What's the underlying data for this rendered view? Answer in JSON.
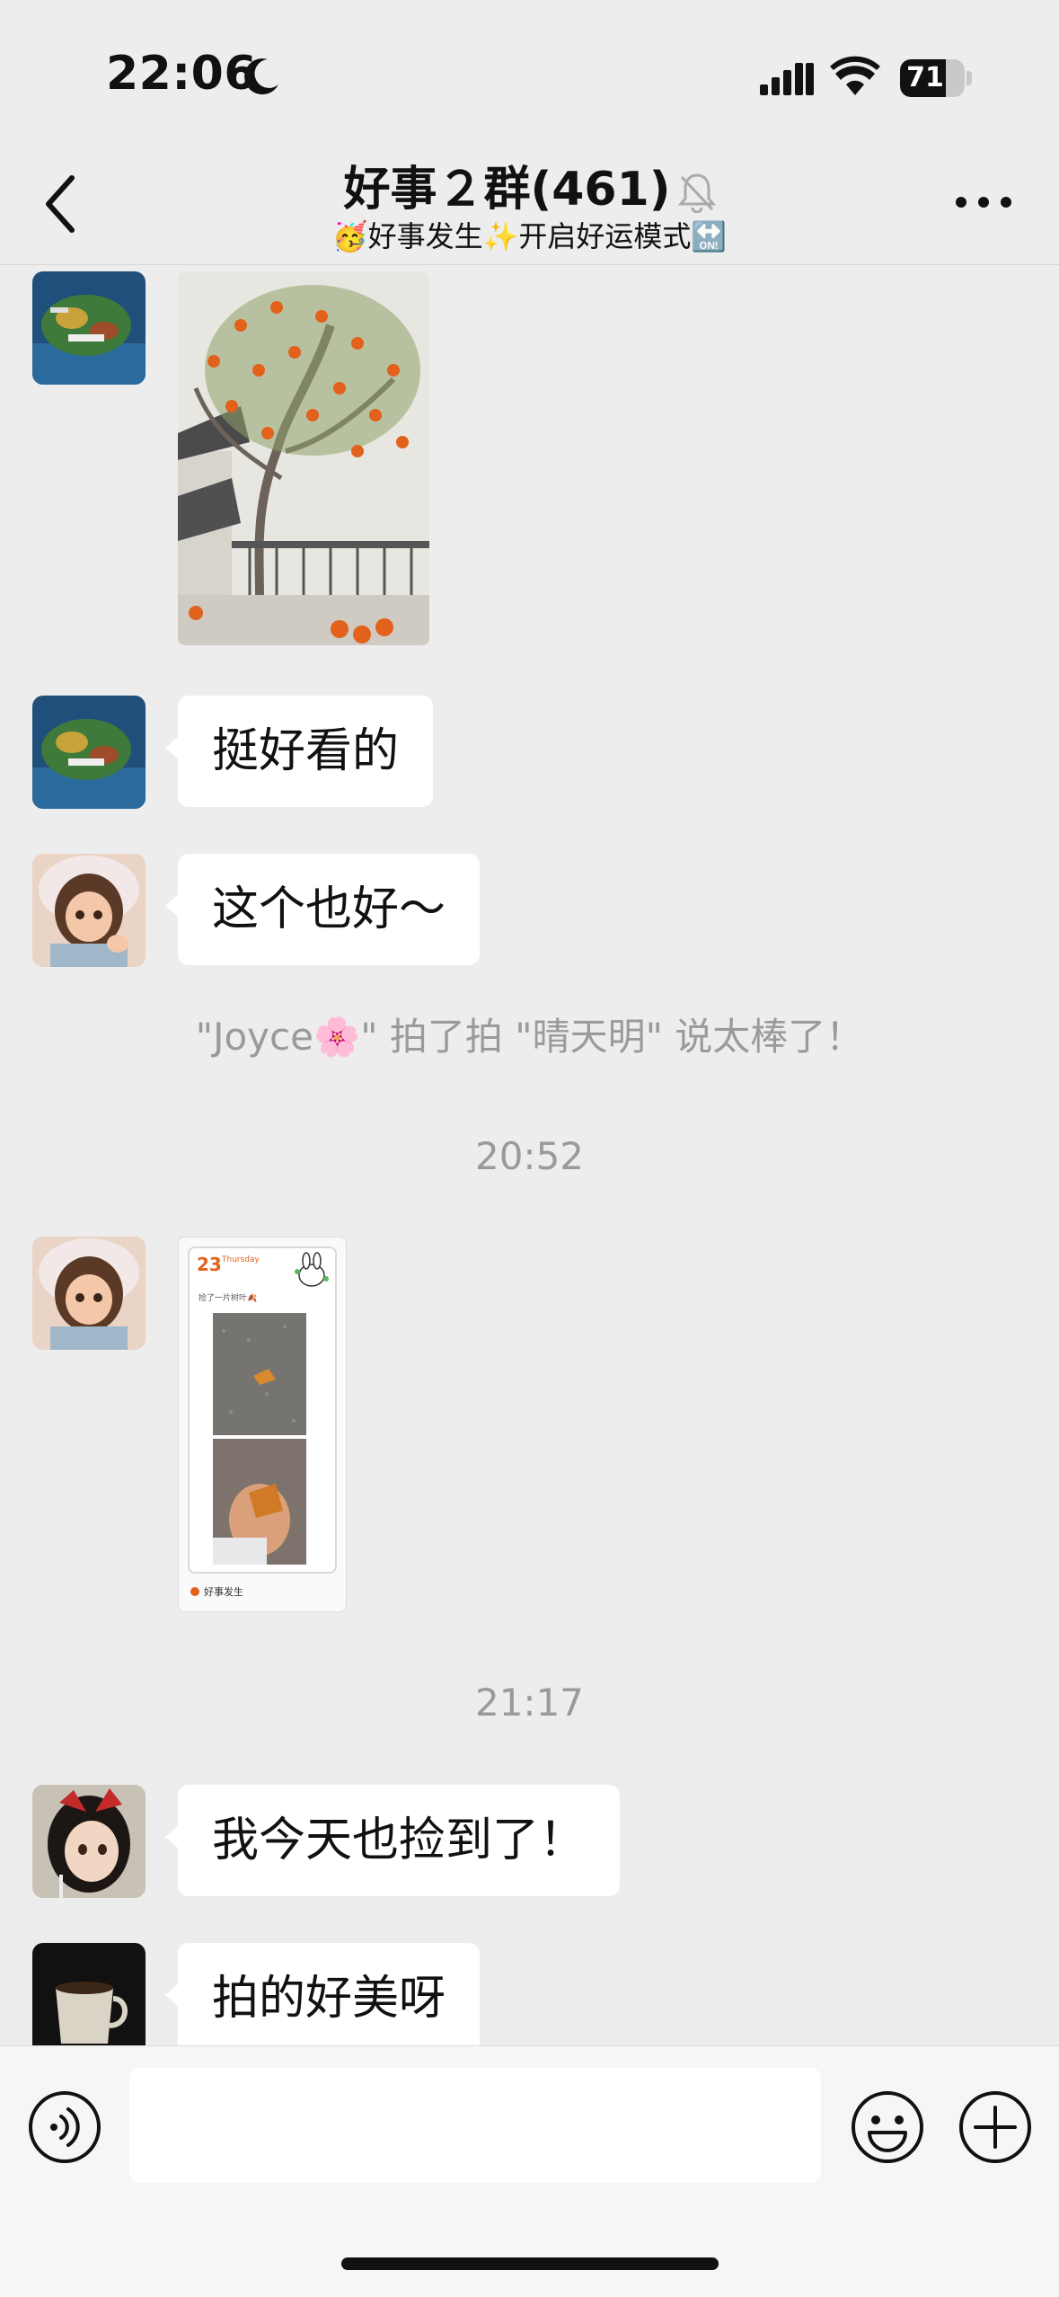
{
  "status": {
    "time": "22:06",
    "battery": "71",
    "battery_level": 0.71
  },
  "header": {
    "title": "好事２群(461)",
    "subtitle": "🥳好事发生✨开启好运模式🔛"
  },
  "messages": [
    {
      "type": "image",
      "sender": "scenic-avatar",
      "image": "persimmon-tree painting"
    },
    {
      "type": "text",
      "sender": "scenic-avatar",
      "text": "挺好看的"
    },
    {
      "type": "text",
      "sender": "girl-avatar",
      "text": "这个也好～"
    },
    {
      "type": "system",
      "text": "\"Joyce🌸\" 拍了拍 \"晴天明\" 说太棒了！"
    },
    {
      "type": "time",
      "text": "20:52"
    },
    {
      "type": "image",
      "sender": "girl-avatar",
      "card": {
        "day": "23",
        "weekday": "Thursday",
        "caption": "捡了一片树叶🍂",
        "footer": "好事发生"
      }
    },
    {
      "type": "time",
      "text": "21:17"
    },
    {
      "type": "text",
      "sender": "anime-avatar",
      "text": "我今天也捡到了！"
    },
    {
      "type": "text",
      "sender": "coffee-avatar",
      "text": "拍的好美呀"
    }
  ],
  "input": {
    "value": "",
    "placeholder": ""
  }
}
